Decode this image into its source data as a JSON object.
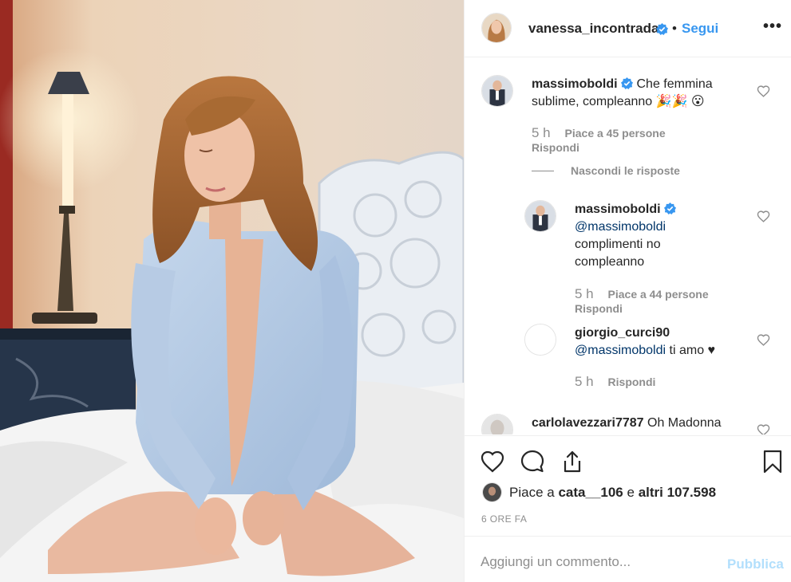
{
  "post": {
    "author": "vanessa_incontrada",
    "follow_label": "Segui",
    "dot": "•",
    "more_label": "•••"
  },
  "comments": [
    {
      "user": "massimoboldi",
      "text": "Che femmina sublime, compleanno 🎉🎉 😮",
      "time": "5 h",
      "likes": "Piace a 45 persone",
      "reply_label": "Rispondi"
    }
  ],
  "hide_replies_label": "Nascondi le risposte",
  "replies": [
    {
      "user": "massimoboldi",
      "mention": "@massimoboldi",
      "text_line1": "complimenti no",
      "text_line2": "compleanno",
      "time": "5 h",
      "likes": "Piace a 44 persone",
      "reply_label": "Rispondi"
    },
    {
      "user": "giorgio_curci90",
      "mention": "@massimoboldi",
      "text": "ti amo ♥",
      "time": "5 h",
      "reply_label": "Rispondi"
    }
  ],
  "next_comment": {
    "user": "carlolavezzari7787",
    "text": "Oh Madonna"
  },
  "likes_summary": {
    "prefix": "Piace a",
    "user": "cata__106",
    "middle": "e",
    "others": "altri 107.598"
  },
  "post_time": "6 ORE FA",
  "comment_box": {
    "placeholder": "Aggiungi un commento...",
    "publish_label": "Pubblica"
  },
  "icons": {
    "like": "heart-icon",
    "comment": "comment-icon",
    "share": "share-icon",
    "save": "bookmark-icon",
    "verified": "verified-badge-icon",
    "comment_like": "heart-icon"
  },
  "colors": {
    "link": "#3897f0",
    "publish_disabled": "#b2dffc",
    "muted": "#8e8e8e",
    "text": "#262626",
    "mention": "#003569"
  }
}
